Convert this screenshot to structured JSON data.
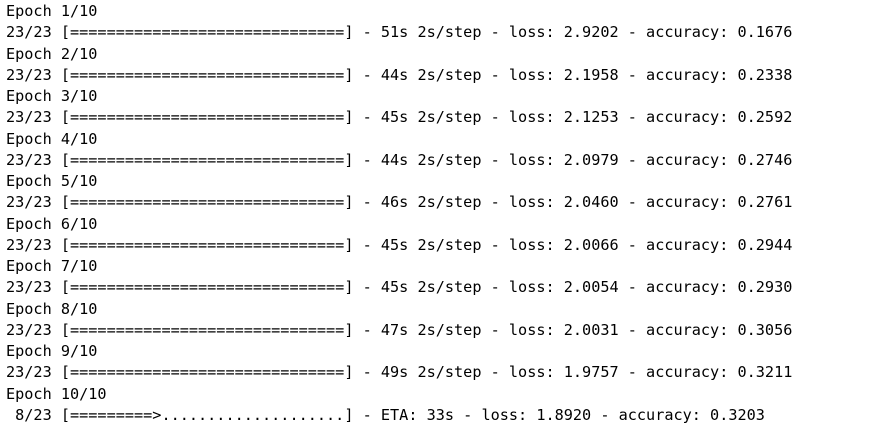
{
  "console": {
    "lines": [
      "Epoch 1/10",
      "23/23 [==============================] - 51s 2s/step - loss: 2.9202 - accuracy: 0.1676",
      "Epoch 2/10",
      "23/23 [==============================] - 44s 2s/step - loss: 2.1958 - accuracy: 0.2338",
      "Epoch 3/10",
      "23/23 [==============================] - 45s 2s/step - loss: 2.1253 - accuracy: 0.2592",
      "Epoch 4/10",
      "23/23 [==============================] - 44s 2s/step - loss: 2.0979 - accuracy: 0.2746",
      "Epoch 5/10",
      "23/23 [==============================] - 46s 2s/step - loss: 2.0460 - accuracy: 0.2761",
      "Epoch 6/10",
      "23/23 [==============================] - 45s 2s/step - loss: 2.0066 - accuracy: 0.2944",
      "Epoch 7/10",
      "23/23 [==============================] - 45s 2s/step - loss: 2.0054 - accuracy: 0.2930",
      "Epoch 8/10",
      "23/23 [==============================] - 47s 2s/step - loss: 2.0031 - accuracy: 0.3056",
      "Epoch 9/10",
      "23/23 [==============================] - 49s 2s/step - loss: 1.9757 - accuracy: 0.3211",
      "Epoch 10/10",
      " 8/23 [=========>....................] - ETA: 33s - loss: 1.8920 - accuracy: 0.3203"
    ]
  }
}
